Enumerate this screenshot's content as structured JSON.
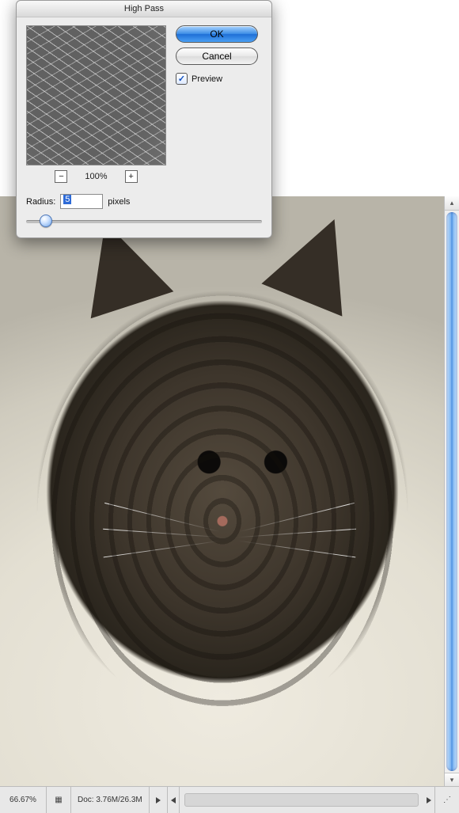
{
  "dialog": {
    "title": "High Pass",
    "ok_label": "OK",
    "cancel_label": "Cancel",
    "preview_label": "Preview",
    "preview_checked": true,
    "zoom_pct": "100%",
    "radius_label": "Radius:",
    "radius_value": "5",
    "radius_unit": "pixels",
    "slider_percent": 8
  },
  "statusbar": {
    "zoom": "66.67%",
    "doc_info": "Doc: 3.76M/26.3M"
  }
}
